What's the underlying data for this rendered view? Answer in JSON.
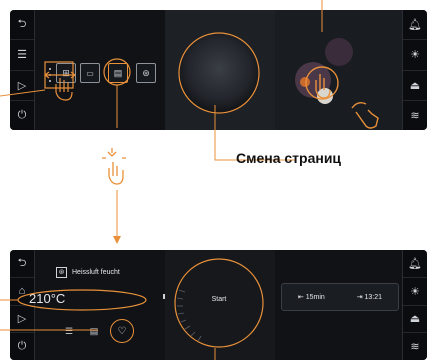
{
  "caption": "Смена страниц",
  "top_panel": {
    "left_rail_icons": [
      "back-icon",
      "menu-icon",
      "play-icon",
      "power-icon"
    ],
    "right_rail_icons": [
      "bell-icon",
      "light-icon",
      "tray-icon",
      "steam-icon"
    ],
    "mode_tiles": [
      "hot-air-icon",
      "top-heat-icon",
      "grill-icon",
      "fan-icon"
    ]
  },
  "bottom_panel": {
    "mode_label": "Heissluft feucht",
    "temperature": "210°C",
    "start_label": "Start",
    "duration": "15min",
    "end_time": "13:21",
    "left_rail_icons": [
      "back-icon",
      "home-icon",
      "play-icon",
      "power-icon"
    ],
    "right_rail_icons": [
      "bell-icon",
      "light-icon",
      "tray-icon",
      "steam-icon"
    ]
  },
  "colors": {
    "accent": "#e8903a",
    "panel": "#101216",
    "caption": "#111111"
  }
}
